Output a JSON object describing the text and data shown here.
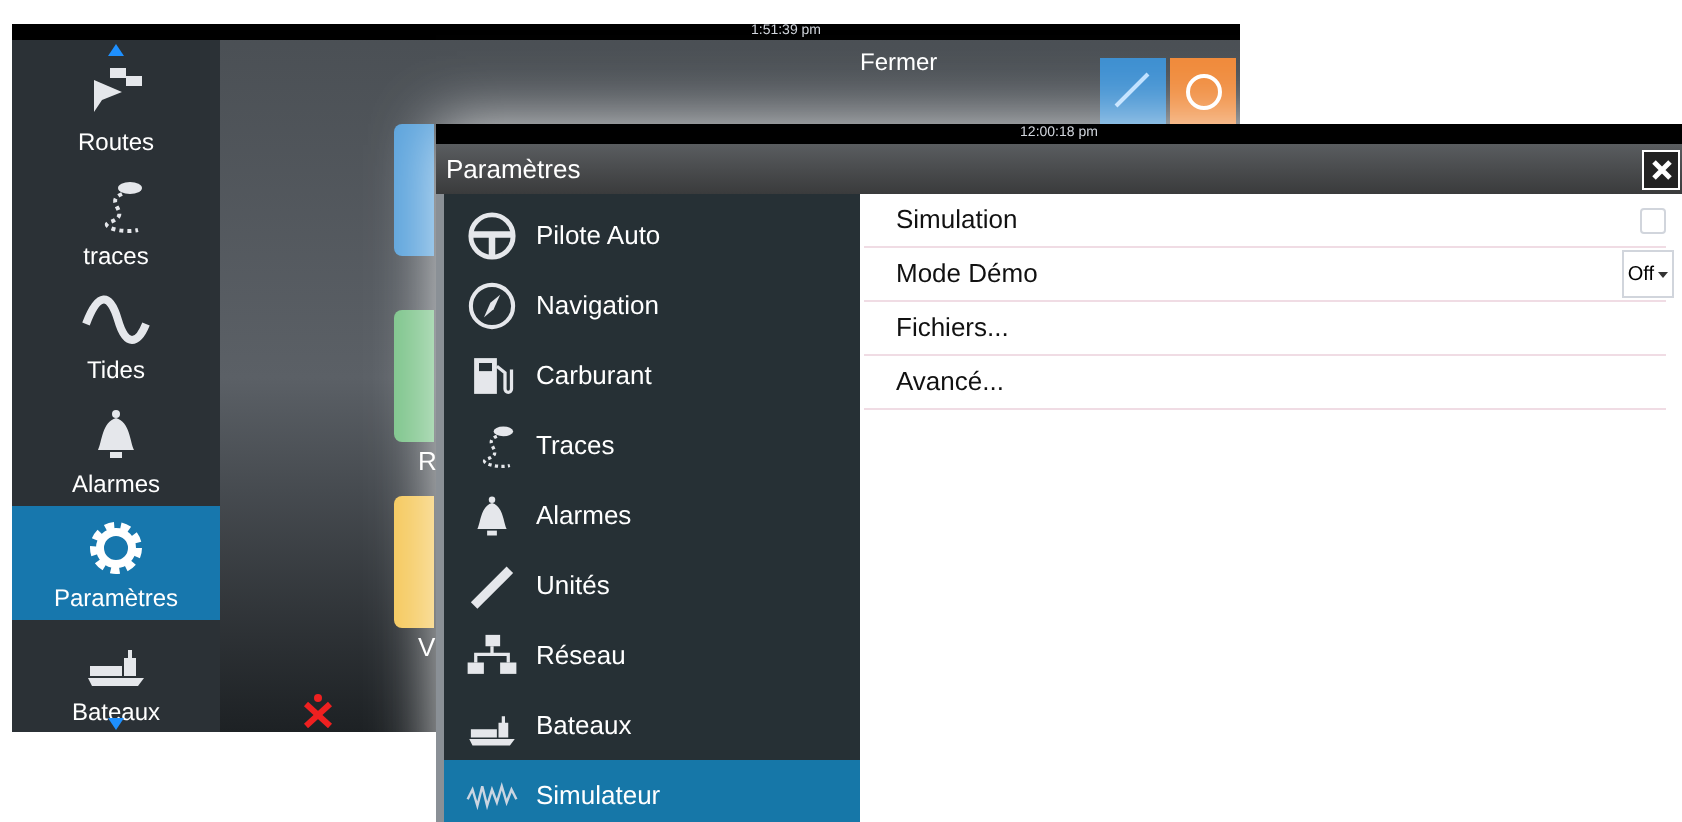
{
  "background_screen": {
    "clock": "1:51:39 pm",
    "close_label": "Fermer",
    "sidebar": [
      {
        "kind": "routes",
        "label": "Routes",
        "selected": false
      },
      {
        "kind": "traces",
        "label": "traces",
        "selected": false
      },
      {
        "kind": "tides",
        "label": "Tides",
        "selected": false
      },
      {
        "kind": "alarms",
        "label": "Alarmes",
        "selected": false
      },
      {
        "kind": "settings",
        "label": "Paramètres",
        "selected": true
      },
      {
        "kind": "vessels",
        "label": "Bateaux",
        "selected": false
      }
    ],
    "tiles": [
      {
        "color": "#5ba3dc"
      },
      {
        "label": "R",
        "color": "#7cc48a"
      },
      {
        "label": "V",
        "color": "#f5c85a"
      }
    ]
  },
  "settings_window": {
    "clock": "12:00:18 pm",
    "title": "Paramètres",
    "categories": [
      {
        "kind": "autopilot",
        "label": "Pilote Auto",
        "selected": false
      },
      {
        "kind": "navigation",
        "label": "Navigation",
        "selected": false
      },
      {
        "kind": "fuel",
        "label": "Carburant",
        "selected": false
      },
      {
        "kind": "traces",
        "label": "Traces",
        "selected": false
      },
      {
        "kind": "alarms",
        "label": "Alarmes",
        "selected": false
      },
      {
        "kind": "units",
        "label": "Unités",
        "selected": false
      },
      {
        "kind": "network",
        "label": "Réseau",
        "selected": false
      },
      {
        "kind": "vessels",
        "label": "Bateaux",
        "selected": false
      },
      {
        "kind": "simulator",
        "label": "Simulateur",
        "selected": true
      }
    ],
    "options": [
      {
        "kind": "checkbox",
        "label": "Simulation",
        "checked": false
      },
      {
        "kind": "dropdown",
        "label": "Mode Démo",
        "value": "Off"
      },
      {
        "kind": "link",
        "label": "Fichiers..."
      },
      {
        "kind": "link",
        "label": "Avancé..."
      }
    ]
  }
}
